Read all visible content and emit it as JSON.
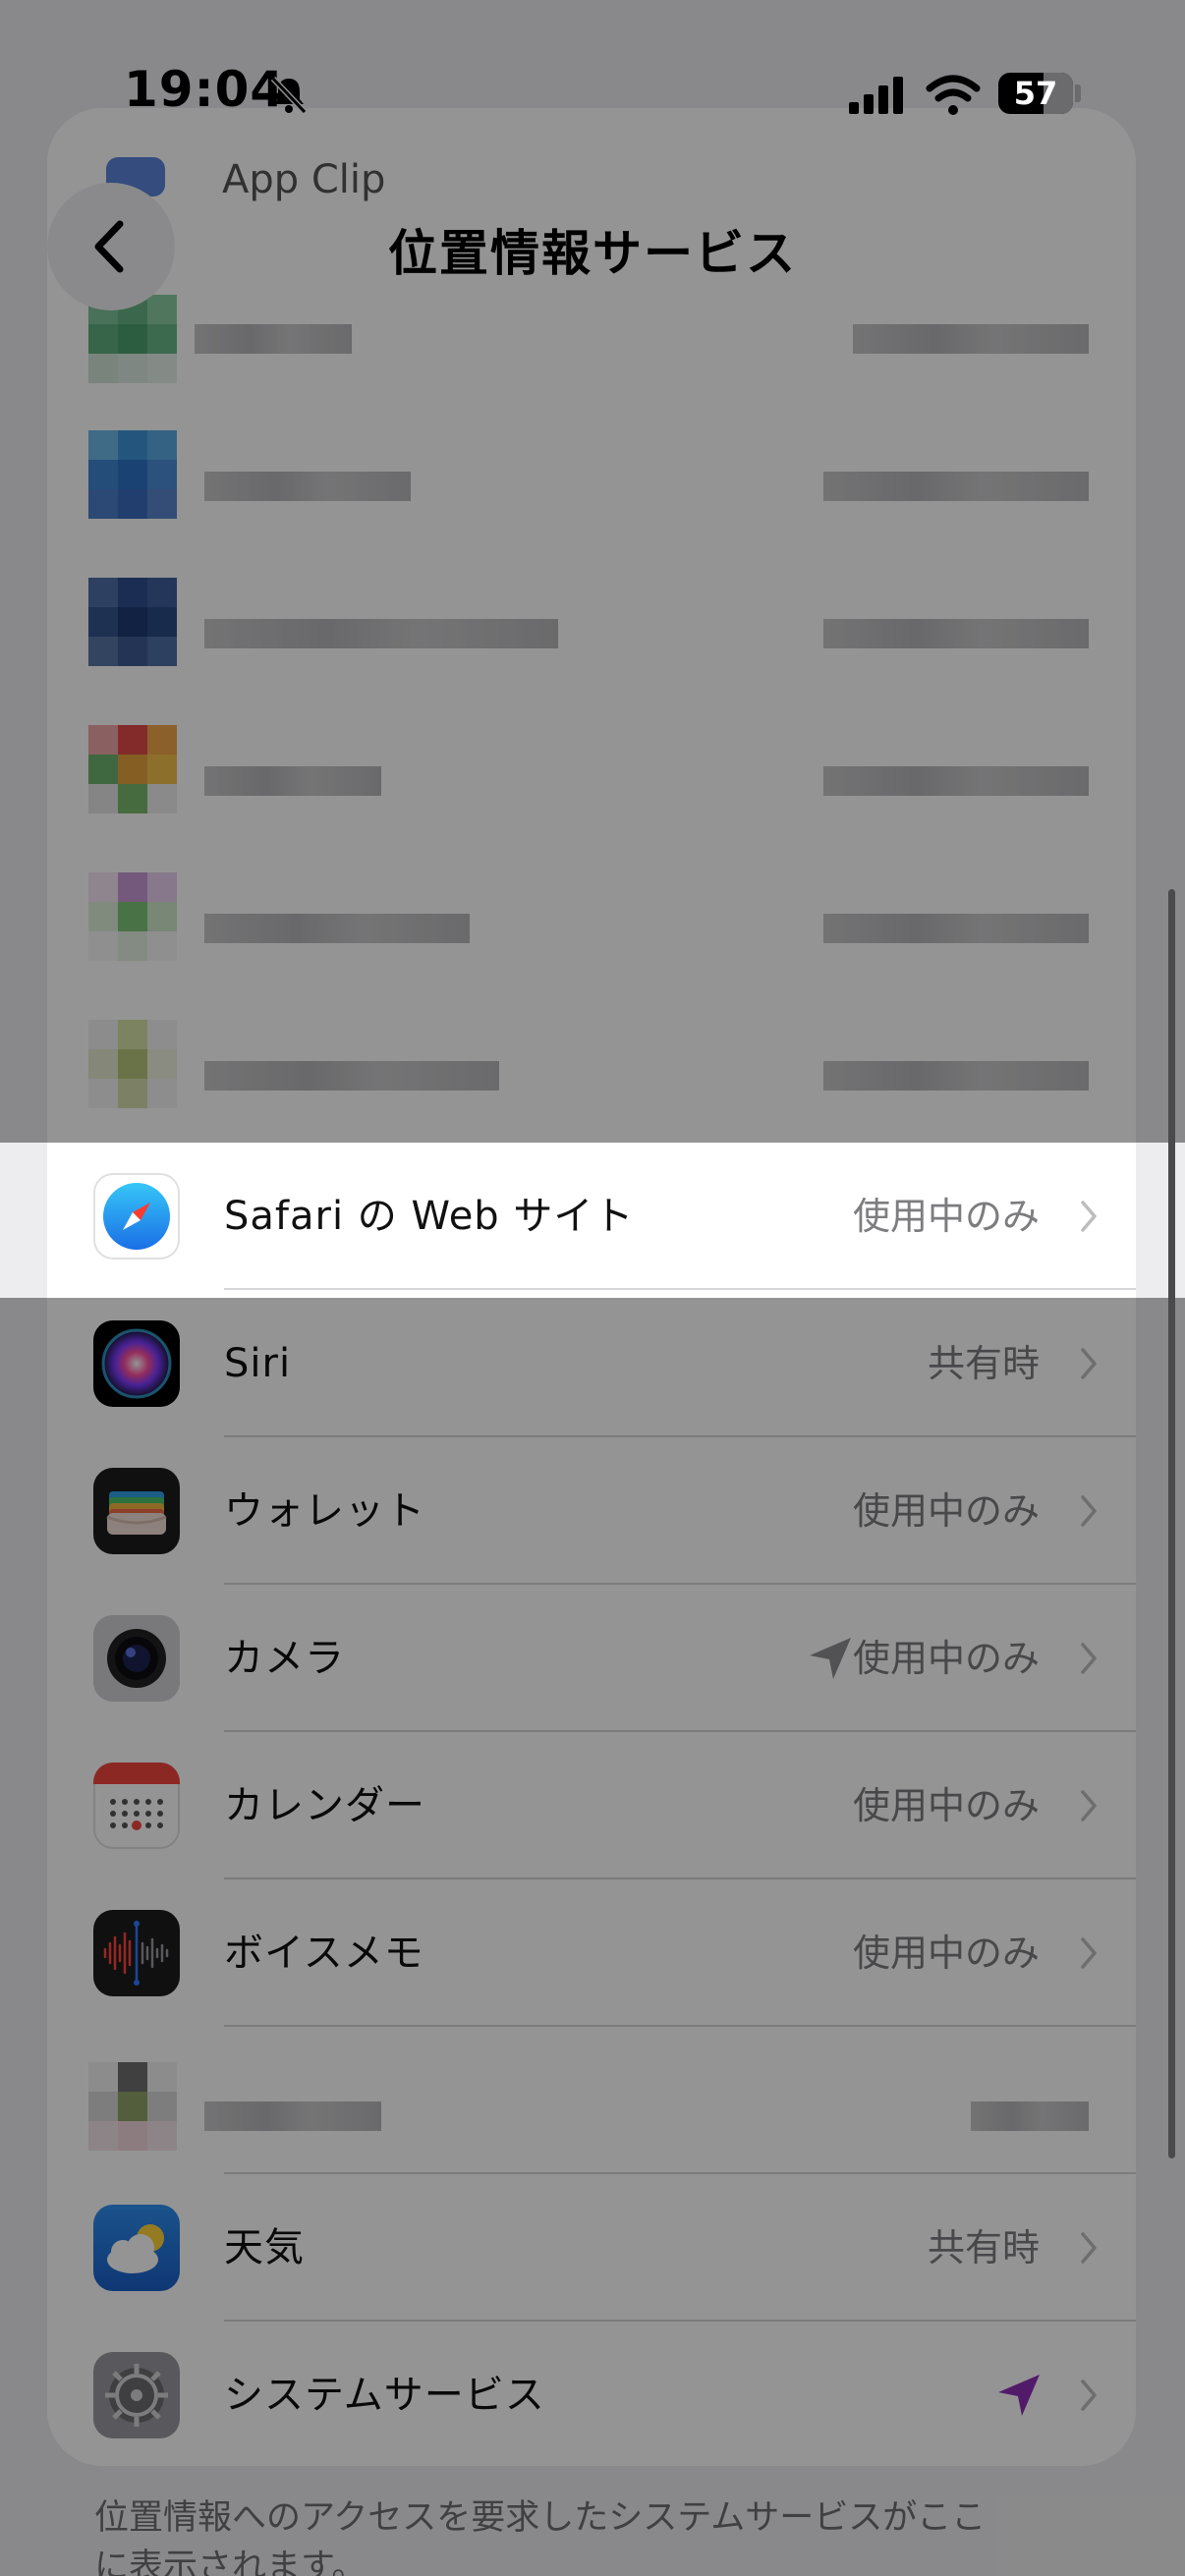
{
  "status_bar": {
    "time": "19:04",
    "battery_level": "57"
  },
  "nav": {
    "title": "位置情報サービス",
    "top_hidden_row_label": "App Clip"
  },
  "rows": [
    {
      "label": "Safari の Web サイト",
      "value": "使用中のみ",
      "icon": "safari-icon"
    },
    {
      "label": "Siri",
      "value": "共有時",
      "icon": "siri-icon"
    },
    {
      "label": "ウォレット",
      "value": "使用中のみ",
      "icon": "wallet-icon"
    },
    {
      "label": "カメラ",
      "value": "使用中のみ",
      "icon": "camera-icon",
      "recent_use": true
    },
    {
      "label": "カレンダー",
      "value": "使用中のみ",
      "icon": "calendar-icon"
    },
    {
      "label": "ボイスメモ",
      "value": "使用中のみ",
      "icon": "voice-memos-icon"
    },
    {
      "label": "天気",
      "value": "共有時",
      "icon": "weather-icon"
    },
    {
      "label": "システムサービス",
      "value": "",
      "icon": "system-services-icon",
      "recent_use": true
    }
  ],
  "footer": {
    "note": "位置情報へのアクセスを要求したシステムサービスがここに表示されます。"
  },
  "colors": {
    "accent_purple": "#8e2fb6",
    "value_gray": "#7d7d80",
    "background": "#ededf0"
  }
}
